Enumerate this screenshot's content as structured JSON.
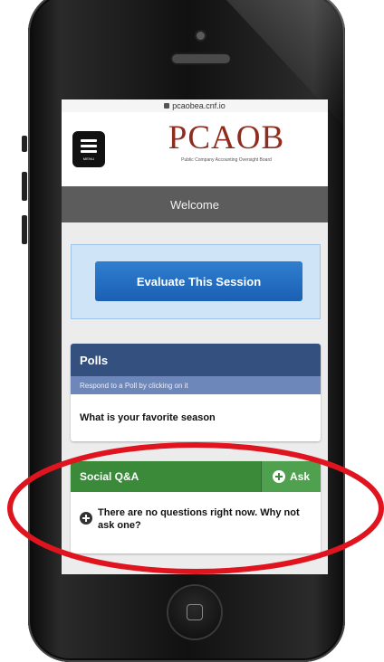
{
  "browser": {
    "url": "pcaobea.cnf.io"
  },
  "header": {
    "menu_label": "MENU",
    "logo_text": "PCAOB",
    "logo_subtitle": "Public Company Accounting Oversight Board"
  },
  "welcome_bar": {
    "text": "Welcome"
  },
  "evaluate": {
    "button_label": "Evaluate This Session"
  },
  "polls": {
    "title": "Polls",
    "subtitle": "Respond to a Poll by clicking on it",
    "items": [
      "What is your favorite season"
    ]
  },
  "social_qa": {
    "title": "Social Q&A",
    "ask_label": "Ask",
    "empty_message": "There are no questions right now. Why not ask one?"
  },
  "colors": {
    "logo": "#8e2d1e",
    "polls_header": "#34507e",
    "qa_header": "#3a8a3a",
    "evaluate_button": "#1b5fb3",
    "annotation": "#e0141e"
  }
}
